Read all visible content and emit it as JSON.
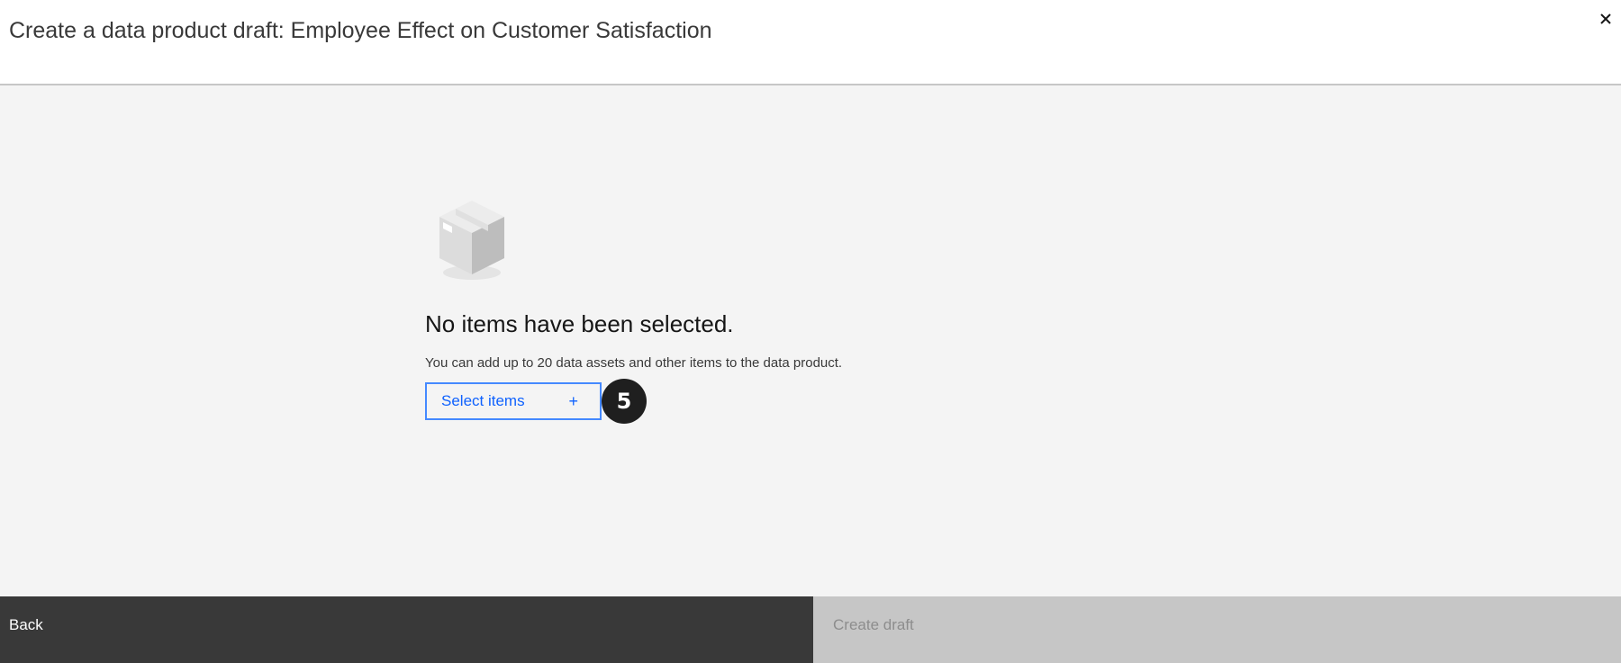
{
  "modal": {
    "title": "Create a data product draft: Employee Effect on Customer Satisfaction",
    "close_icon": "close-icon"
  },
  "empty_state": {
    "illustration": "box-icon",
    "heading": "No items have been selected.",
    "description": "You can add up to 20 data assets and other items to the data product.",
    "select_button_label": "Select items",
    "select_button_icon": "+",
    "step_badge": "5"
  },
  "footer": {
    "back_label": "Back",
    "create_label": "Create draft"
  },
  "colors": {
    "accent": "#0f62fe",
    "body_bg": "#f4f4f4",
    "footer_dark": "#393939",
    "footer_disabled": "#c6c6c6"
  }
}
